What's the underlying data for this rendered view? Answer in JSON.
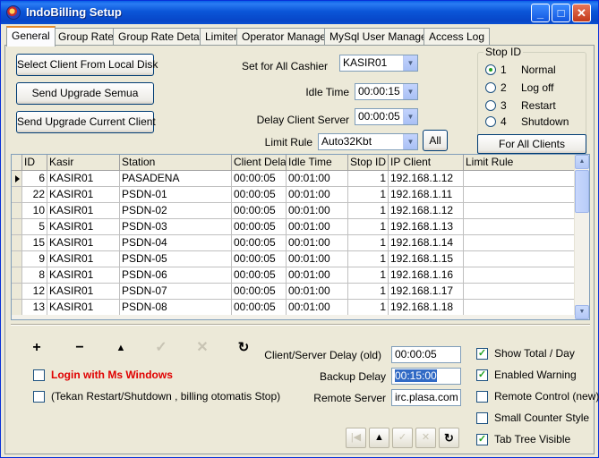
{
  "window": {
    "title": "IndoBilling Setup"
  },
  "title_buttons": {
    "minimize": "_",
    "maximize": "□",
    "close": "✕"
  },
  "tabs": [
    "General",
    "Group Rate",
    "Group Rate Detail",
    "Limiter",
    "Operator Manager",
    "MySql User Manager",
    "Access Log"
  ],
  "buttons": {
    "select_client": "Select Client From Local Disk",
    "send_upgrade_semua": "Send Upgrade Semua",
    "send_upgrade_current": "Send Upgrade Current Client",
    "all": "All",
    "for_all_clients": "For All Clients"
  },
  "settings": {
    "set_for_all_cashier_label": "Set for All Cashier",
    "set_for_all_cashier_value": "KASIR01",
    "idle_time_label": "Idle Time",
    "idle_time_value": "00:00:15",
    "delay_client_server_label": "Delay Client Server",
    "delay_client_server_value": "00:00:05",
    "limit_rule_label": "Limit Rule",
    "limit_rule_value": "Auto32Kbt"
  },
  "stop_id": {
    "legend": "Stop ID",
    "options": [
      {
        "num": "1",
        "label": "Normal",
        "selected": true
      },
      {
        "num": "2",
        "label": "Log off",
        "selected": false
      },
      {
        "num": "3",
        "label": "Restart",
        "selected": false
      },
      {
        "num": "4",
        "label": "Shutdown",
        "selected": false
      }
    ]
  },
  "grid": {
    "columns": [
      "ID",
      "Kasir",
      "Station",
      "Client Delay",
      "Idle Time",
      "Stop ID",
      "IP Client",
      "Limit Rule"
    ],
    "rows": [
      [
        "6",
        "KASIR01",
        "PASADENA",
        "00:00:05",
        "00:01:00",
        "1",
        "192.168.1.12",
        ""
      ],
      [
        "22",
        "KASIR01",
        "PSDN-01",
        "00:00:05",
        "00:01:00",
        "1",
        "192.168.1.11",
        ""
      ],
      [
        "10",
        "KASIR01",
        "PSDN-02",
        "00:00:05",
        "00:01:00",
        "1",
        "192.168.1.12",
        ""
      ],
      [
        "5",
        "KASIR01",
        "PSDN-03",
        "00:00:05",
        "00:01:00",
        "1",
        "192.168.1.13",
        ""
      ],
      [
        "15",
        "KASIR01",
        "PSDN-04",
        "00:00:05",
        "00:01:00",
        "1",
        "192.168.1.14",
        ""
      ],
      [
        "9",
        "KASIR01",
        "PSDN-05",
        "00:00:05",
        "00:01:00",
        "1",
        "192.168.1.15",
        ""
      ],
      [
        "8",
        "KASIR01",
        "PSDN-06",
        "00:00:05",
        "00:01:00",
        "1",
        "192.168.1.16",
        ""
      ],
      [
        "12",
        "KASIR01",
        "PSDN-07",
        "00:00:05",
        "00:01:00",
        "1",
        "192.168.1.17",
        ""
      ],
      [
        "13",
        "KASIR01",
        "PSDN-08",
        "00:00:05",
        "00:01:00",
        "1",
        "192.168.1.18",
        ""
      ]
    ]
  },
  "toolbar_icons": [
    "plus-icon",
    "minus-icon",
    "triangle-up-icon",
    "check-icon",
    "x-icon",
    "refresh-icon"
  ],
  "lower": {
    "login_ms_windows": "Login with Ms Windows",
    "tekan_restart": "(Tekan Restart/Shutdown , billing otomatis Stop)",
    "client_server_delay_label": "Client/Server Delay  (old)",
    "client_server_delay_value": "00:00:05",
    "backup_delay_label": "Backup Delay",
    "backup_delay_value": "00:15:00",
    "remote_server_label": "Remote Server",
    "remote_server_value": "irc.plasa.com"
  },
  "options": [
    {
      "label": "Show Total  / Day",
      "checked": true
    },
    {
      "label": "Enabled  Warning",
      "checked": true
    },
    {
      "label": "Remote Control (new)",
      "checked": false
    },
    {
      "label": "Small Counter Style",
      "checked": false
    },
    {
      "label": "Tab Tree Visible",
      "checked": true
    }
  ]
}
